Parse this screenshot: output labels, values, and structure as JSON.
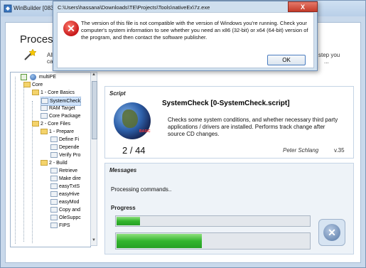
{
  "main_window": {
    "title": "WinBuilder [083",
    "heading": "Process",
    "intro_left_1": "All g",
    "intro_left_2": "can",
    "intro_right": "step you",
    "intro_right_2": "..."
  },
  "tree": {
    "items": [
      {
        "label": "multiPE"
      },
      {
        "label": "Core"
      },
      {
        "label": "1 - Core Basics"
      },
      {
        "label": "SystemCheck"
      },
      {
        "label": "RAM Target"
      },
      {
        "label": "Core Package"
      },
      {
        "label": "2 - Core Files"
      },
      {
        "label": "1 - Prepare"
      },
      {
        "label": "Define Fi"
      },
      {
        "label": "Depende"
      },
      {
        "label": "Verify Pro"
      },
      {
        "label": "2 - Build"
      },
      {
        "label": "Retrieve"
      },
      {
        "label": "Make dire"
      },
      {
        "label": "easyTxtS"
      },
      {
        "label": "easyHive"
      },
      {
        "label": "easyMod"
      },
      {
        "label": "Copy and"
      },
      {
        "label": "OleSuppc"
      },
      {
        "label": "FIPS"
      }
    ]
  },
  "script_panel": {
    "caption": "Script",
    "title": "SystemCheck [0-SystemCheck.script]",
    "description": "Checks some system conditions, and whether necessary third party applications / drivers are installed. Performs track change after source CD changes.",
    "author": "Peter Schlang",
    "version": "v.35",
    "counter": "2 / 44",
    "logo_tag": "BASIC"
  },
  "messages_panel": {
    "caption": "Messages",
    "text": "Processing commands..",
    "progress_label": "Progress",
    "progress_1": 0.12,
    "progress_2": 0.44
  },
  "dialog": {
    "title": "C:\\Users\\hassana\\Downloads\\TE\\Projects\\Tools\\nativeEx\\7z.exe",
    "message": "The version of this file is not compatible with the version of Windows you're running. Check your computer's system information to see whether you need an x86 (32-bit) or x64 (64-bit) version of the program, and then contact the software publisher.",
    "ok_label": "OK",
    "close_label": "X"
  },
  "colors": {
    "progress_green": "#33b52e",
    "error_red": "#c7181a",
    "window_blue": "#c9d9eb"
  }
}
